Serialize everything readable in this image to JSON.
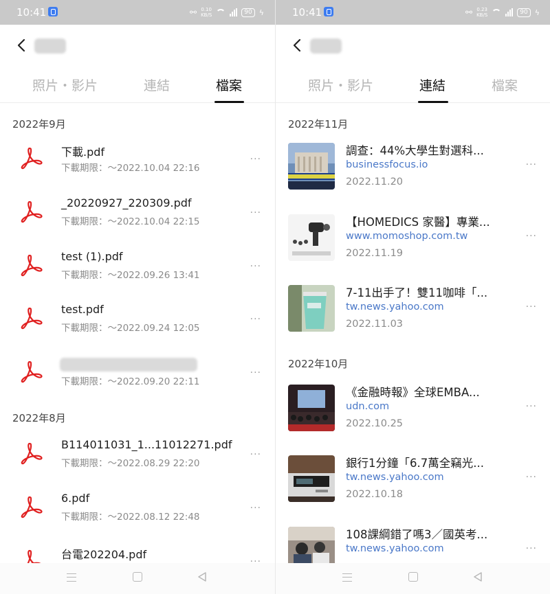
{
  "colors": {
    "statusbar_bg": "#c9c9c9",
    "link_blue": "#4a78c8",
    "pdf_red": "#e02020",
    "muted_text": "#8a8a8a",
    "active_tab": "#111111",
    "inactive_tab": "#b5b5b5"
  },
  "left": {
    "status": {
      "time": "10:41",
      "net_speed": "0.10",
      "net_unit": "KB/S",
      "battery": "90"
    },
    "tabs": [
      {
        "label": "照片・影片",
        "active": false
      },
      {
        "label": "連結",
        "active": false
      },
      {
        "label": "檔案",
        "active": true
      }
    ],
    "sections": [
      {
        "date": "2022年9月",
        "items": [
          {
            "name": "下載.pdf",
            "expiry": "下載期限：～2022.10.04 22:16"
          },
          {
            "name": "_20220927_220309.pdf",
            "expiry": "下載期限：～2022.10.04 22:15"
          },
          {
            "name": "test (1).pdf",
            "expiry": "下載期限：～2022.09.26 13:41"
          },
          {
            "name": "test.pdf",
            "expiry": "下載期限：～2022.09.24 12:05"
          },
          {
            "name": "",
            "expiry": "下載期限：～2022.09.20 22:11"
          }
        ]
      },
      {
        "date": "2022年8月",
        "items": [
          {
            "name": "B114011031_1...11012271.pdf",
            "expiry": "下載期限：～2022.08.29 22:20"
          },
          {
            "name": "6.pdf",
            "expiry": "下載期限：～2022.08.12 22:48"
          },
          {
            "name": "台電202204.pdf",
            "expiry": ""
          }
        ]
      }
    ],
    "more_label": "···"
  },
  "right": {
    "status": {
      "time": "10:41",
      "net_speed": "0.23",
      "net_unit": "KB/S",
      "battery": "90"
    },
    "tabs": [
      {
        "label": "照片・影片",
        "active": false
      },
      {
        "label": "連結",
        "active": true
      },
      {
        "label": "檔案",
        "active": false
      }
    ],
    "sections": [
      {
        "date": "2022年11月",
        "items": [
          {
            "title": "調查：44%大學生對選科...",
            "domain": "businessfocus.io",
            "date": "2022.11.20",
            "thumb": "university-building-thumbnail"
          },
          {
            "title": "【HOMEDICS 家醫】專業...",
            "domain": "www.momoshop.com.tw",
            "date": "2022.11.19",
            "thumb": "massage-gun-thumbnail"
          },
          {
            "title": "7-11出手了！雙11咖啡「...",
            "domain": "tw.news.yahoo.com",
            "date": "2022.11.03",
            "thumb": "coffee-cup-thumbnail"
          }
        ]
      },
      {
        "date": "2022年10月",
        "items": [
          {
            "title": "《金融時報》全球EMBA...",
            "domain": "udn.com",
            "date": "2022.10.25",
            "thumb": "graduation-hall-thumbnail"
          },
          {
            "title": "銀行1分鐘「6.7萬全竊光...",
            "domain": "tw.news.yahoo.com",
            "date": "2022.10.18",
            "thumb": "atm-machine-thumbnail"
          },
          {
            "title": "108課綱錯了嗎3／國英考...",
            "domain": "tw.news.yahoo.com",
            "date": "",
            "thumb": "classroom-students-thumbnail"
          }
        ]
      }
    ],
    "more_label": "···"
  }
}
